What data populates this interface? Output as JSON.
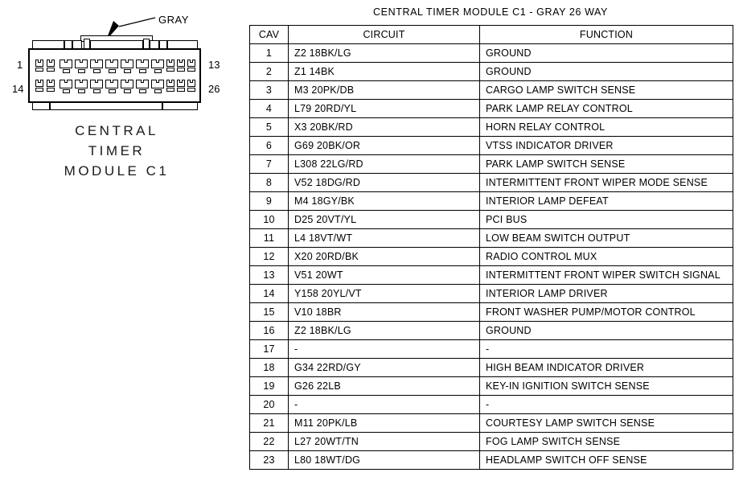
{
  "diagram": {
    "gray_label": "GRAY",
    "pin_numbers": {
      "top_left": "1",
      "bottom_left": "14",
      "top_right": "13",
      "bottom_right": "26"
    },
    "caption_line1": "CENTRAL",
    "caption_line2": "TIMER",
    "caption_line3": "MODULE C1",
    "cavities_per_row": 13,
    "total_cavities": 26
  },
  "table": {
    "title": "CENTRAL TIMER MODULE C1 - GRAY 26 WAY",
    "headers": {
      "cav": "CAV",
      "circuit": "CIRCUIT",
      "function": "FUNCTION"
    },
    "rows": [
      {
        "cav": "1",
        "circuit": "Z2 18BK/LG",
        "function": "GROUND"
      },
      {
        "cav": "2",
        "circuit": "Z1 14BK",
        "function": "GROUND"
      },
      {
        "cav": "3",
        "circuit": "M3 20PK/DB",
        "function": "CARGO LAMP SWITCH SENSE"
      },
      {
        "cav": "4",
        "circuit": "L79 20RD/YL",
        "function": "PARK LAMP RELAY CONTROL"
      },
      {
        "cav": "5",
        "circuit": "X3 20BK/RD",
        "function": "HORN RELAY CONTROL"
      },
      {
        "cav": "6",
        "circuit": "G69 20BK/OR",
        "function": "VTSS INDICATOR DRIVER"
      },
      {
        "cav": "7",
        "circuit": "L308 22LG/RD",
        "function": "PARK LAMP SWITCH SENSE"
      },
      {
        "cav": "8",
        "circuit": "V52 18DG/RD",
        "function": "INTERMITTENT FRONT WIPER MODE SENSE"
      },
      {
        "cav": "9",
        "circuit": "M4 18GY/BK",
        "function": "INTERIOR LAMP DEFEAT"
      },
      {
        "cav": "10",
        "circuit": "D25 20VT/YL",
        "function": "PCI BUS"
      },
      {
        "cav": "11",
        "circuit": "L4 18VT/WT",
        "function": "LOW BEAM SWITCH OUTPUT"
      },
      {
        "cav": "12",
        "circuit": "X20 20RD/BK",
        "function": "RADIO CONTROL MUX"
      },
      {
        "cav": "13",
        "circuit": "V51 20WT",
        "function": "INTERMITTENT FRONT WIPER SWITCH SIGNAL"
      },
      {
        "cav": "14",
        "circuit": "Y158 20YL/VT",
        "function": "INTERIOR LAMP DRIVER"
      },
      {
        "cav": "15",
        "circuit": "V10 18BR",
        "function": "FRONT WASHER PUMP/MOTOR CONTROL"
      },
      {
        "cav": "16",
        "circuit": "Z2 18BK/LG",
        "function": "GROUND"
      },
      {
        "cav": "17",
        "circuit": "-",
        "function": "-"
      },
      {
        "cav": "18",
        "circuit": "G34 22RD/GY",
        "function": "HIGH BEAM INDICATOR DRIVER"
      },
      {
        "cav": "19",
        "circuit": "G26 22LB",
        "function": "KEY-IN IGNITION SWITCH SENSE"
      },
      {
        "cav": "20",
        "circuit": "-",
        "function": "-"
      },
      {
        "cav": "21",
        "circuit": "M11 20PK/LB",
        "function": "COURTESY LAMP SWITCH SENSE"
      },
      {
        "cav": "22",
        "circuit": "L27 20WT/TN",
        "function": "FOG LAMP SWITCH SENSE"
      },
      {
        "cav": "23",
        "circuit": "L80 18WT/DG",
        "function": "HEADLAMP SWITCH OFF SENSE"
      }
    ]
  }
}
